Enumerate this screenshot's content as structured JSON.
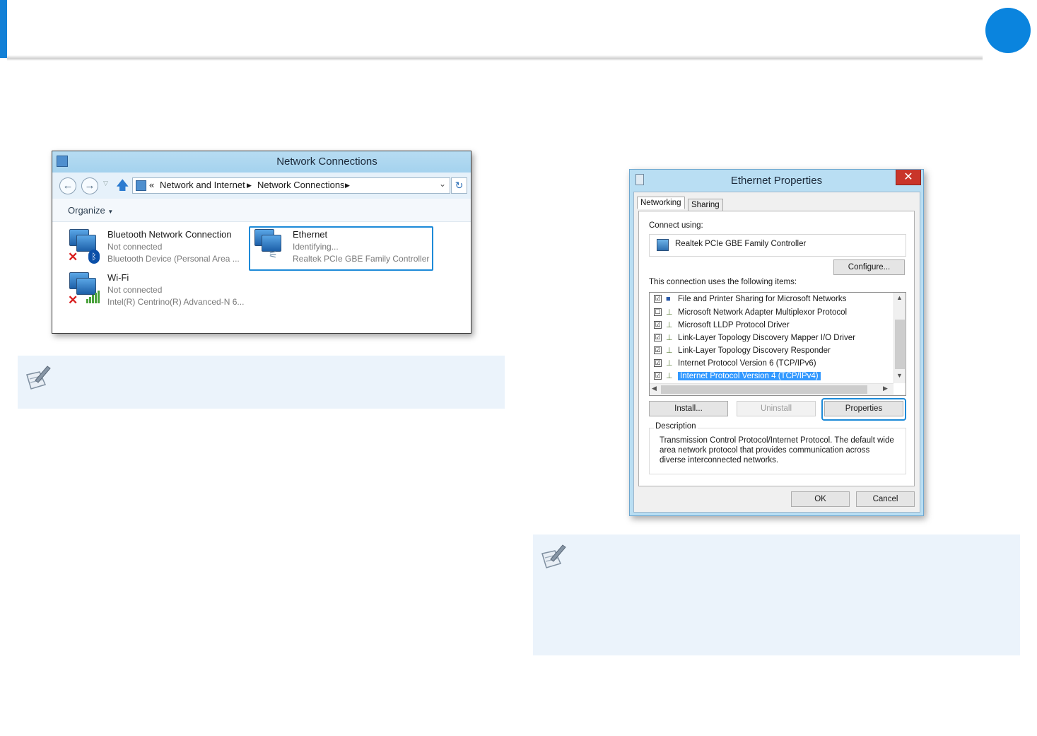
{
  "header": {
    "accent_color": "#1280d6",
    "circle_color": "#0a84de"
  },
  "network_connections": {
    "title": "Network Connections",
    "breadcrumb_sep": "«",
    "breadcrumbs": [
      "Network and Internet",
      "Network Connections"
    ],
    "organize_label": "Organize",
    "connections": [
      {
        "name": "Bluetooth Network Connection",
        "status": "Not connected",
        "device": "Bluetooth Device (Personal Area ..."
      },
      {
        "name": "Ethernet",
        "status": "Identifying...",
        "device": "Realtek PCIe GBE Family Controller"
      },
      {
        "name": "Wi-Fi",
        "status": "Not connected",
        "device": "Intel(R) Centrino(R) Advanced-N 6..."
      }
    ]
  },
  "ethernet_properties": {
    "title": "Ethernet Properties",
    "close_glyph": "✕",
    "tabs": [
      "Networking",
      "Sharing"
    ],
    "connect_using_label": "Connect using:",
    "adapter_name": "Realtek PCIe GBE Family Controller",
    "configure_label": "Configure...",
    "items_label": "This connection uses the following items:",
    "items": [
      {
        "label": "File and Printer Sharing for Microsoft Networks",
        "checked": "☑"
      },
      {
        "label": "Microsoft Network Adapter Multiplexor Protocol",
        "checked": "☐"
      },
      {
        "label": "Microsoft LLDP Protocol Driver",
        "checked": "☑"
      },
      {
        "label": "Link-Layer Topology Discovery Mapper I/O Driver",
        "checked": "☑"
      },
      {
        "label": "Link-Layer Topology Discovery Responder",
        "checked": "☑"
      },
      {
        "label": "Internet Protocol Version 6 (TCP/IPv6)",
        "checked": "☑"
      },
      {
        "label": "Internet Protocol Version 4 (TCP/IPv4)",
        "checked": "☑"
      }
    ],
    "install_label": "Install...",
    "uninstall_label": "Uninstall",
    "properties_label": "Properties",
    "description_title": "Description",
    "description_text": "Transmission Control Protocol/Internet Protocol. The default wide area network protocol that provides communication across diverse interconnected networks.",
    "ok_label": "OK",
    "cancel_label": "Cancel"
  }
}
